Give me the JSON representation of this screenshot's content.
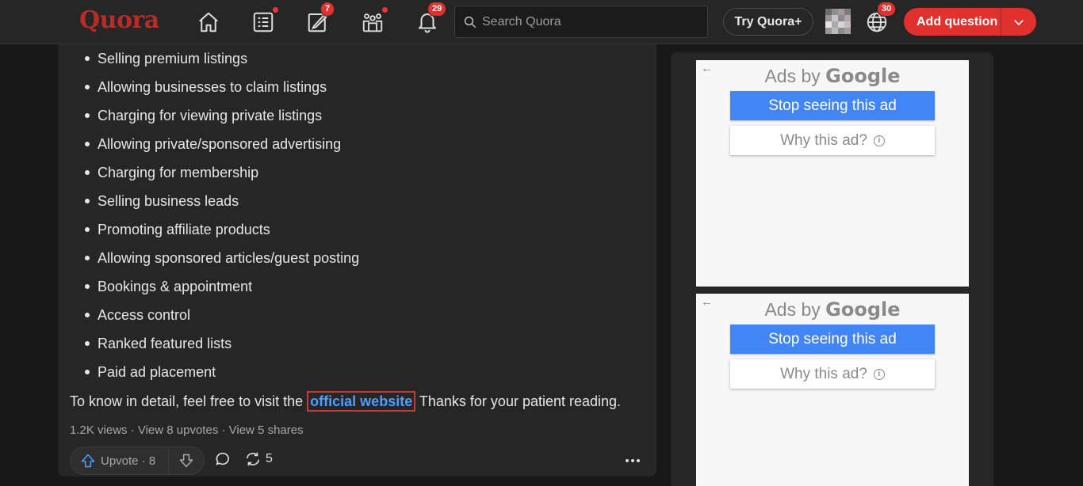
{
  "header": {
    "logo": "Quora",
    "notifications": {
      "following_dot": true,
      "answer_badge": "7",
      "spaces_dot": true,
      "bell_badge": "29"
    },
    "search_placeholder": "Search Quora",
    "try_plus": "Try Quora+",
    "language_badge": "30",
    "add_question": "Add question"
  },
  "answer": {
    "list_items": [
      "Selling premium listings",
      "Allowing businesses to claim listings",
      "Charging for viewing private listings",
      "Allowing private/sponsored advertising",
      "Charging for membership",
      "Selling business leads",
      "Promoting affiliate products",
      "Allowing sponsored articles/guest posting",
      "Bookings & appointment",
      "Access control",
      "Ranked featured lists",
      "Paid ad placement"
    ],
    "para_before": "To know in detail, feel free to visit the",
    "link_text": "official website",
    "para_after": " Thanks for your patient reading.",
    "meta": "1.2K views · View 8 upvotes · View 5 shares",
    "upvote_label": "Upvote · 8",
    "share_count": "5"
  },
  "ads": [
    {
      "title_prefix": "Ads by ",
      "title_brand": "Google",
      "stop": "Stop seeing this ad",
      "why": "Why this ad?"
    },
    {
      "title_prefix": "Ads by ",
      "title_brand": "Google",
      "stop": "Stop seeing this ad",
      "why": "Why this ad?"
    }
  ],
  "colors": {
    "brand": "#b92b27",
    "accent": "#e0312f",
    "link": "#4d9eff",
    "ad_button": "#4285f4"
  }
}
